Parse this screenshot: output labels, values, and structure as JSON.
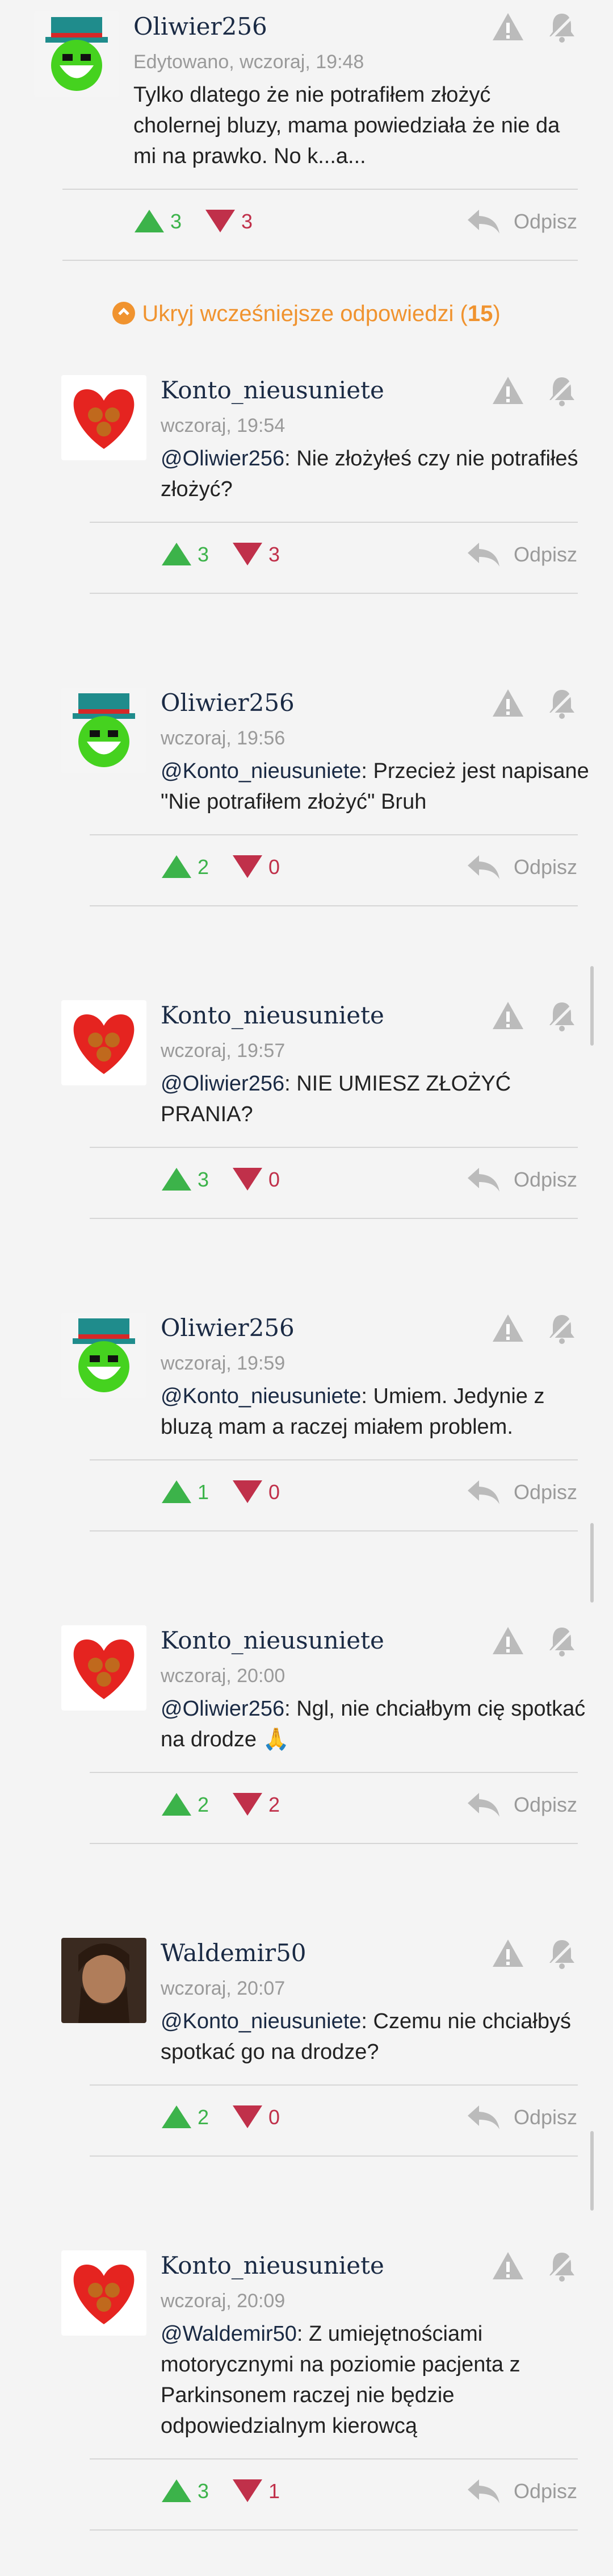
{
  "toggle": {
    "label": "Ukryj wcześniejsze odpowiedzi",
    "count_open": " (",
    "count": "15",
    "count_close": ")"
  },
  "comments": [
    {
      "author": "Oliwier256",
      "meta": "Edytowano, wczoraj, 19:48",
      "mention": "",
      "text": "Tylko dlatego że nie potrafiłem złożyć cholernej bluzy, mama powiedziała że nie da mi na prawko. No k...a...",
      "up": "3",
      "down": "3",
      "reply": "Odpisz"
    },
    {
      "author": "Konto_nieusuniete",
      "meta": "wczoraj, 19:54",
      "mention": "@Oliwier256",
      "text": ": Nie złożyłeś czy nie potrafiłeś złożyć?",
      "up": "3",
      "down": "3",
      "reply": "Odpisz"
    },
    {
      "author": "Oliwier256",
      "meta": "wczoraj, 19:56",
      "mention": "@Konto_nieusuniete",
      "text": ": Przecież jest napisane \"Nie potrafiłem złożyć\" Bruh",
      "up": "2",
      "down": "0",
      "reply": "Odpisz"
    },
    {
      "author": "Konto_nieusuniete",
      "meta": "wczoraj, 19:57",
      "mention": "@Oliwier256",
      "text": ": NIE UMIESZ ZŁOŻYĆ PRANIA?",
      "up": "3",
      "down": "0",
      "reply": "Odpisz"
    },
    {
      "author": "Oliwier256",
      "meta": "wczoraj, 19:59",
      "mention": "@Konto_nieusuniete",
      "text": ": Umiem. Jedynie z bluzą mam a raczej miałem problem.",
      "up": "1",
      "down": "0",
      "reply": "Odpisz"
    },
    {
      "author": "Konto_nieusuniete",
      "meta": "wczoraj, 20:00",
      "mention": "@Oliwier256",
      "text": ": Ngl, nie chciałbym cię spotkać na drodze 🙏",
      "up": "2",
      "down": "2",
      "reply": "Odpisz"
    },
    {
      "author": "Waldemir50",
      "meta": "wczoraj, 20:07",
      "mention": "@Konto_nieusuniete",
      "text": ": Czemu nie chciałbyś spotkać go na drodze?",
      "up": "2",
      "down": "0",
      "reply": "Odpisz"
    },
    {
      "author": "Konto_nieusuniete",
      "meta": "wczoraj, 20:09",
      "mention": "@Waldemir50",
      "text": ": Z umiejętnościami motorycznymi na poziomie pacjenta z Parkinsonem raczej nie będzie odpowiedzialnym kierowcą",
      "up": "3",
      "down": "1",
      "reply": "Odpisz"
    }
  ]
}
